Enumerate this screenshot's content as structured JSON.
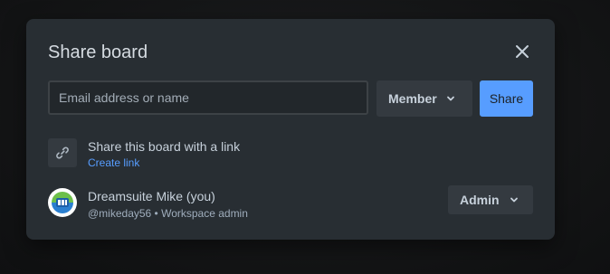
{
  "dialog": {
    "title": "Share board",
    "close_icon": "close-icon"
  },
  "invite": {
    "placeholder": "Email address or name",
    "value": "",
    "role_label": "Member",
    "share_label": "Share"
  },
  "link_share": {
    "icon": "link-icon",
    "title": "Share this board with a link",
    "action_label": "Create link"
  },
  "members": [
    {
      "name": "Dreamsuite Mike (you)",
      "subtitle": "@mikeday56 • Workspace admin",
      "role_label": "Admin",
      "avatar_icon": "avatar-logo"
    }
  ],
  "colors": {
    "dialog_bg": "#282e33",
    "accent": "#579dff",
    "text": "#c7d1db"
  }
}
